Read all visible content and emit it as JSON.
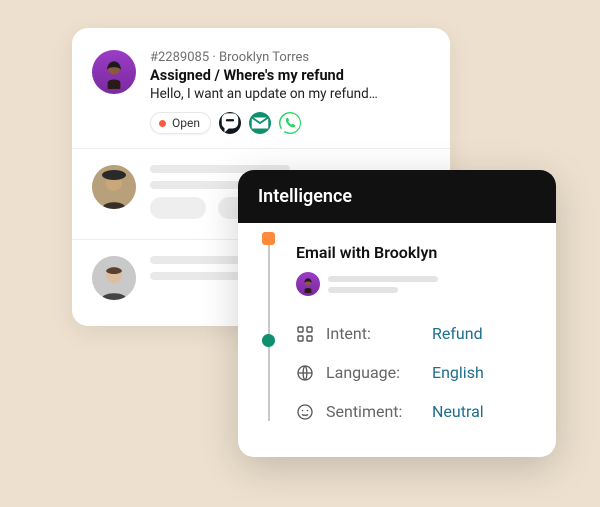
{
  "ticket": {
    "id": "#2289085",
    "separator": " · ",
    "customer_name": "Brooklyn Torres",
    "subject": "Assigned / Where's my refund",
    "preview": "Hello, I want an update on my refund…",
    "status_label": "Open"
  },
  "intelligence": {
    "title": "Intelligence",
    "thread_title": "Email with Brooklyn",
    "items": [
      {
        "key": "intent",
        "label": "Intent:",
        "value": "Refund"
      },
      {
        "key": "language",
        "label": "Language:",
        "value": "English"
      },
      {
        "key": "sentiment",
        "label": "Sentiment:",
        "value": "Neutral"
      }
    ]
  }
}
